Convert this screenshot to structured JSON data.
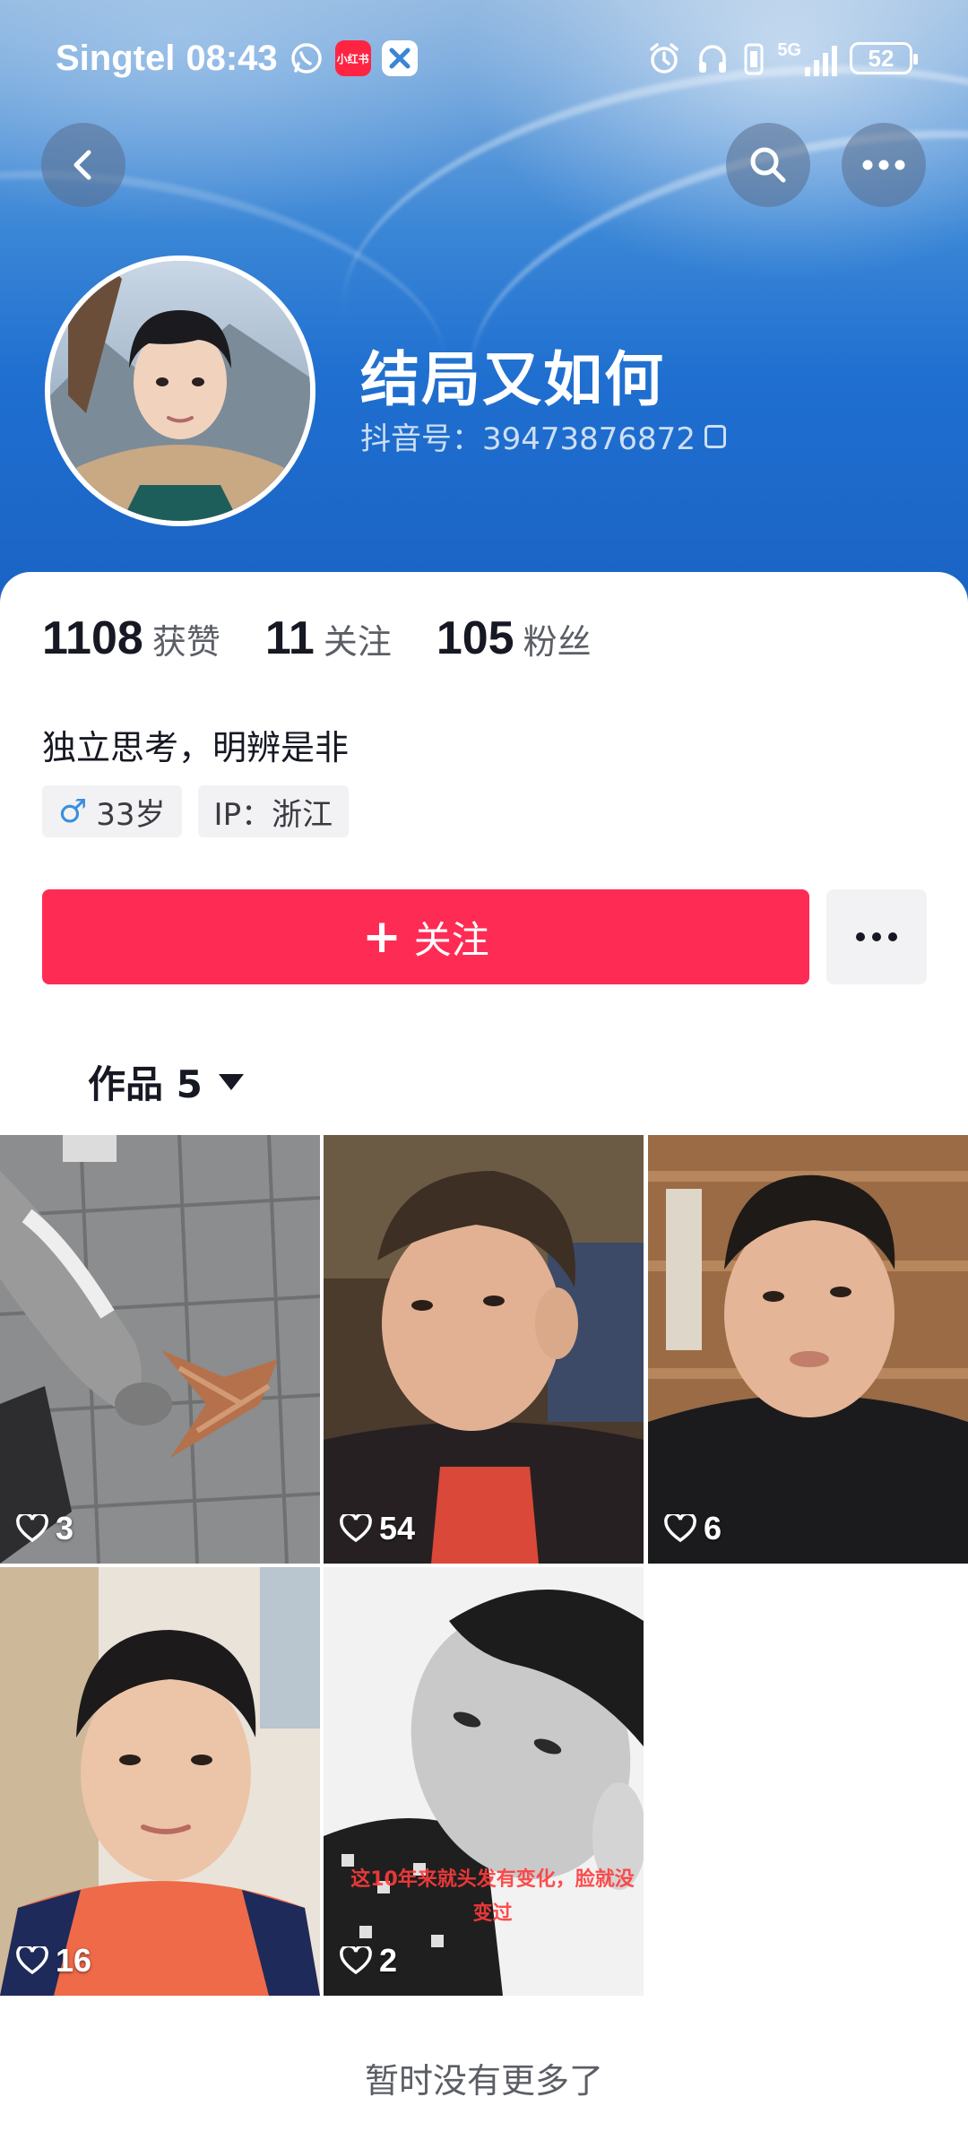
{
  "status_bar": {
    "carrier": "Singtel",
    "time": "08:43",
    "app_badge": "小红书",
    "network": "5G",
    "battery": "52"
  },
  "profile": {
    "name": "结局又如何",
    "douyin_id": "抖音号：39473876872",
    "stats": [
      {
        "value": "1108",
        "label": "获赞"
      },
      {
        "value": "11",
        "label": "关注"
      },
      {
        "value": "105",
        "label": "粉丝"
      }
    ],
    "bio": "独立思考，明辨是非",
    "tags": {
      "age": "33岁",
      "ip": "IP：浙江"
    }
  },
  "actions": {
    "follow_label": "关注"
  },
  "works_tab": {
    "label": "作品 5"
  },
  "videos": [
    {
      "likes": "3"
    },
    {
      "likes": "54"
    },
    {
      "likes": "6"
    },
    {
      "likes": "16"
    },
    {
      "likes": "2",
      "caption": "这10年来就头发有变化，脸就没变过"
    }
  ],
  "footer": {
    "no_more": "暂时没有更多了"
  },
  "colors": {
    "accent": "#fe2c55",
    "header_blue": "#1f6fd0",
    "male_icon": "#3b8fe0"
  }
}
